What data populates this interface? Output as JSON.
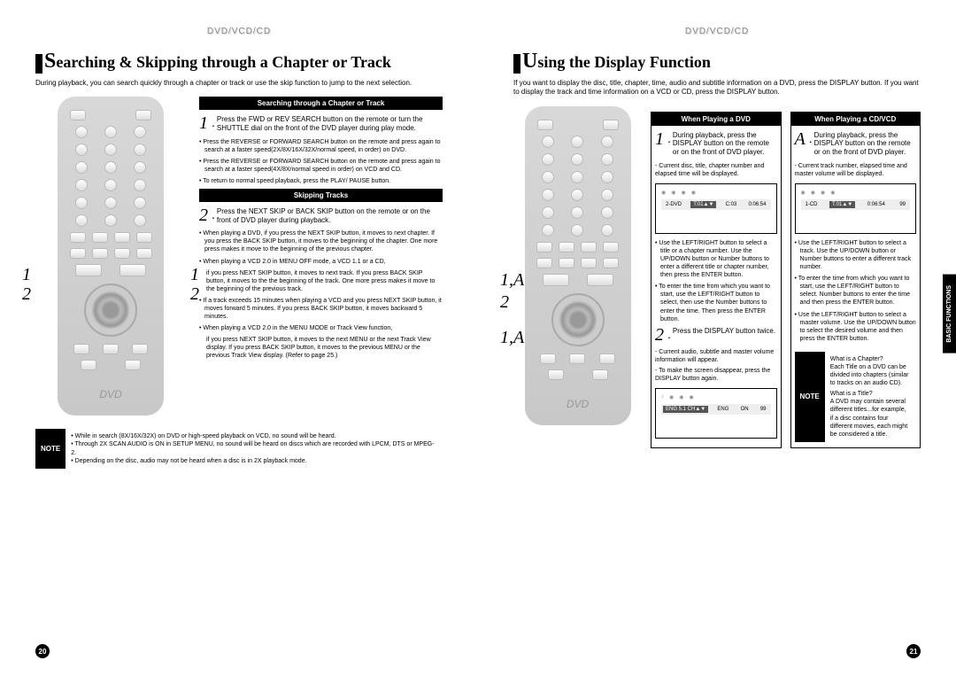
{
  "left": {
    "header": "DVD/VCD/CD",
    "title_first": "S",
    "title_rest": "earching & Skipping through a Chapter or Track",
    "intro": "During playback, you can search quickly through a chapter or track or use the skip function to jump to the next selection.",
    "callouts_left": [
      "1",
      "2"
    ],
    "callouts_right": [
      "1",
      "2"
    ],
    "sec1_header": "Searching through a Chapter or Track",
    "step1_num": "1",
    "step1_text": "Press the FWD or REV SEARCH button on the remote or turn the SHUTTLE dial on the front of the DVD player during play mode.",
    "sec1_b1": "Press the REVERSE or FORWARD SEARCH button on the remote and press again to search at a faster speed(2X/8X/16X/32X/normal speed, in order) on DVD.",
    "sec1_b2": "Press the REVERSE or FORWARD SEARCH button on the remote and press again to search at a faster speed(4X/8X/normal speed in order) on VCD and CD.",
    "sec1_b3": "To return to normal speed playback, press the PLAY/ PAUSE button.",
    "sec2_header": "Skipping Tracks",
    "step2_num": "2",
    "step2_text": "Press the NEXT SKIP or BACK SKIP button on the remote or on the front of DVD player during playback.",
    "sec2_b1": "When playing a DVD, if you press the NEXT SKIP button, it moves to next chapter. If you press the BACK SKIP button, it moves to the beginning of the chapter. One more press makes it move to the beginning of the previous chapter.",
    "sec2_b2": "When playing a VCD 2.0 in MENU OFF mode, a VCD 1.1 or a CD,",
    "sec2_b2_cont": "if you press NEXT SKIP button, it moves to next track. If you press BACK SKIP button, it moves to the the beginning of the track. One more press makes it move to the beginning of the previous track.",
    "sec2_b3": "If a track exceeds 15 minutes when playing a VCD and you press NEXT SKIP button, it moves forward 5 minutes. If you press BACK SKIP button, it moves backward 5 minutes.",
    "sec2_b4": "When playing a VCD 2.0 in the MENU MODE or Track View function,",
    "sec2_b4_cont": "if you press NEXT SKIP button, it moves to the next MENU or the next Track View display. If you press BACK SKIP button, it moves to the previous MENU or the previous Track View display. (Refer to page 25.)",
    "note_label": "NOTE",
    "note1": "While in search (8X/16X/32X) on DVD or high-speed playback on VCD, no sound will be heard.",
    "note2": "Through 2X SCAN AUDIO is ON in SETUP MENU, no sound will be heard on discs which are recorded with LPCM, DTS or MPEG-2.",
    "note3": "Depending on the disc, audio may not be heard when a disc is in 2X playback mode.",
    "page_num": "20"
  },
  "right": {
    "header": "DVD/VCD/CD",
    "title_first": "U",
    "title_rest": "sing the Display Function",
    "intro": "If you want to display the disc, title, chapter, time, audio and subtitle information on a DVD, press the DISPLAY button. If you want to display the track and time information on a VCD or CD, press the DISPLAY button.",
    "callouts": [
      "1,A",
      "2",
      "1,A"
    ],
    "colA_header": "When Playing a DVD",
    "colA_step1_num": "1",
    "colA_step1_text": "During playback, press the DISPLAY button on the remote or on the front of DVD player.",
    "colA_dash1": "- Current disc, title, chapter number and elapsed time will be displayed.",
    "dispA_row": [
      "2-DVD",
      "T:01▲▼",
      "C:03",
      "0:06:54"
    ],
    "colA_b1": "Use the LEFT/RIGHT button to select a title or a chapter number. Use the UP/DOWN button or Number buttons to enter a different title or chapter number, then press the ENTER button.",
    "colA_b2": "To enter the time from which you want to start, use the LEFT/RIGHT button to select, then use the Number buttons to enter the time. Then press the ENTER button.",
    "colA_step2_num": "2",
    "colA_step2_text": "Press the DISPLAY button twice.",
    "colA_dash2": "- Current audio, subtitle and master volume information will appear.",
    "colA_dash3": "- To make the screen disappear, press the DISPLAY button again.",
    "dispA2_row": [
      "ENG 5.1 CH▲▼",
      "ENG",
      "ON",
      "99"
    ],
    "colB_header": "When Playing a CD/VCD",
    "colB_step1_num": "A",
    "colB_step1_text": "During playback, press the DISPLAY button on the remote or on the front of DVD player.",
    "colB_dash1": "- Current track number, elapsed time and master volume will be displayed.",
    "dispB_row": [
      "1-CD",
      "T:01▲▼",
      "0:06:54",
      "99"
    ],
    "colB_b1": "Use the LEFT/RIGHT button to select a track. Use the UP/DOWN button or Number buttons to enter a different track number.",
    "colB_b2": "To enter the time from which you want to start, use the LEFT/RIGHT button to select. Number buttons to enter the time and then press the ENTER button.",
    "colB_b3": "Use the LEFT/RIGHT button to select a master volume. Use the UP/DOWN button to select the desired volume and then press the ENTER button.",
    "note_label": "NOTE",
    "noteQ1": "What is a Chapter?",
    "noteA1": "Each Title on a DVD can be divided into chapters (similar to tracks on an audio CD).",
    "noteQ2": "What is a Title?",
    "noteA2": "A DVD may contain several different titles...for example, if a disc contains four different movies, each might be considered a title.",
    "page_num": "21",
    "side_tab": "BASIC FUNCTIONS"
  }
}
